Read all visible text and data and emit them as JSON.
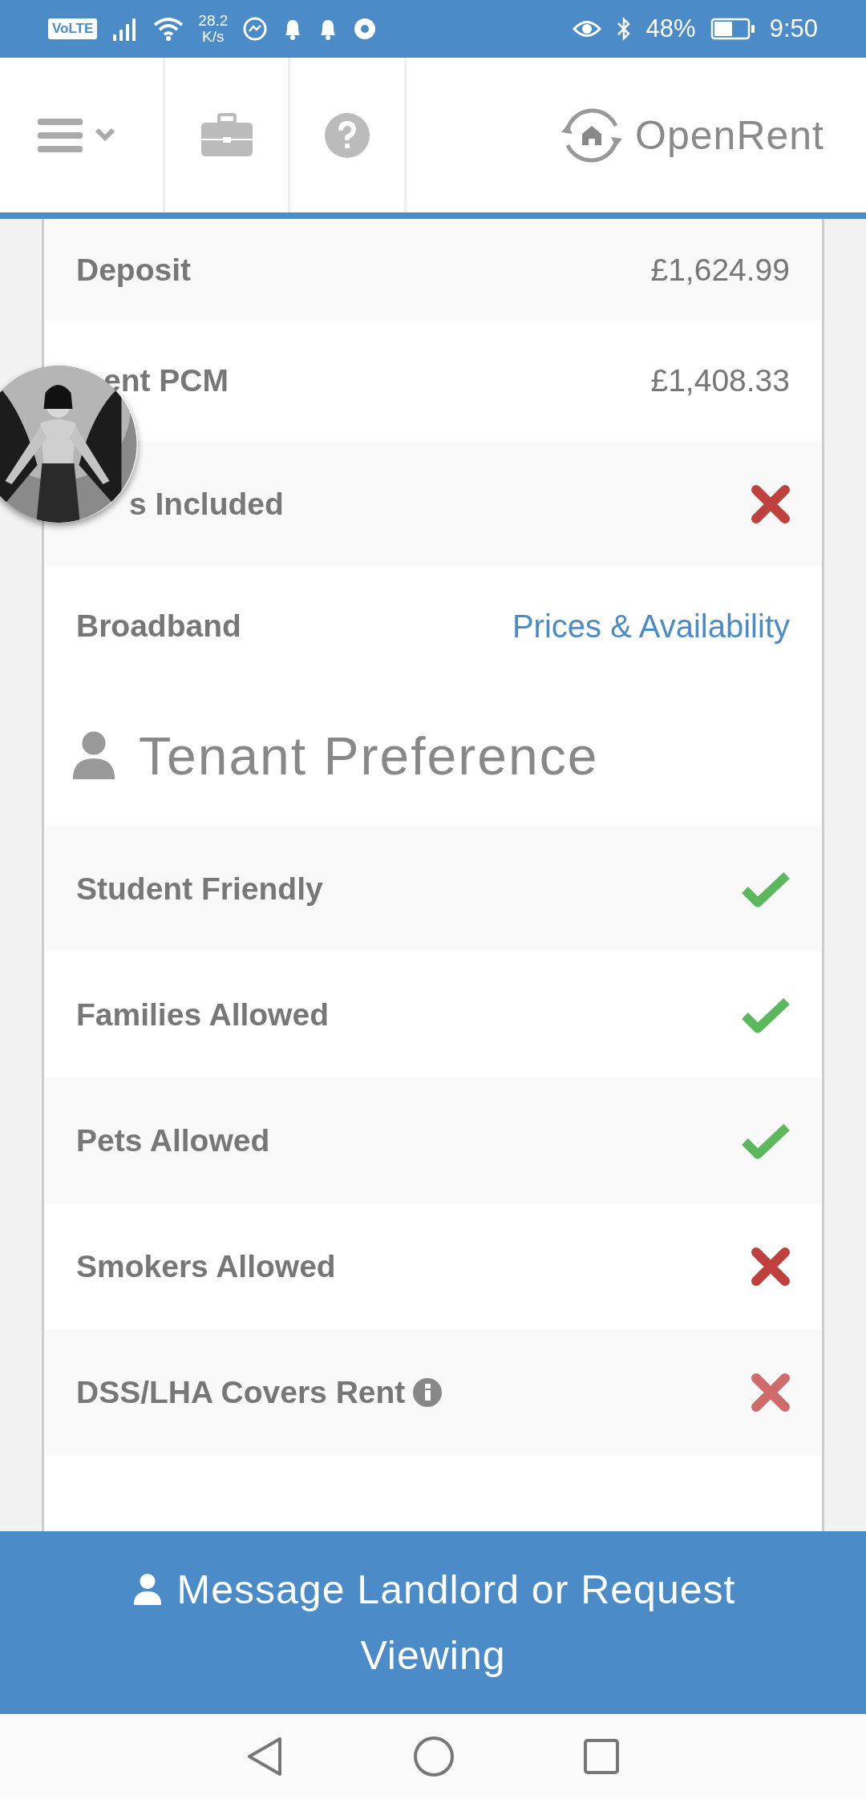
{
  "status_bar": {
    "network_badge": "VoLTE",
    "speed_value": "28.2",
    "speed_unit": "K/s",
    "battery": "48%",
    "time": "9:50"
  },
  "header": {
    "logo_text": "OpenRent"
  },
  "details": [
    {
      "kind": "amount",
      "label": "Deposit",
      "value": "£1,624.99"
    },
    {
      "kind": "amount",
      "label": "ent PCM",
      "value": "£1,408.33"
    },
    {
      "kind": "flag",
      "label": "s Included",
      "allowed": false
    },
    {
      "kind": "link",
      "label": "Broadband",
      "link": "Prices & Availability"
    }
  ],
  "tenant_preference": {
    "title": "Tenant Preference",
    "items": [
      {
        "label": "Student Friendly",
        "allowed": true,
        "info": false
      },
      {
        "label": "Families Allowed",
        "allowed": true,
        "info": false
      },
      {
        "label": "Pets Allowed",
        "allowed": true,
        "info": false
      },
      {
        "label": "Smokers Allowed",
        "allowed": false,
        "info": false
      },
      {
        "label": "DSS/LHA Covers Rent",
        "allowed": false,
        "info": true
      }
    ]
  },
  "action_button": {
    "label": "Message Landlord or Request Viewing"
  }
}
